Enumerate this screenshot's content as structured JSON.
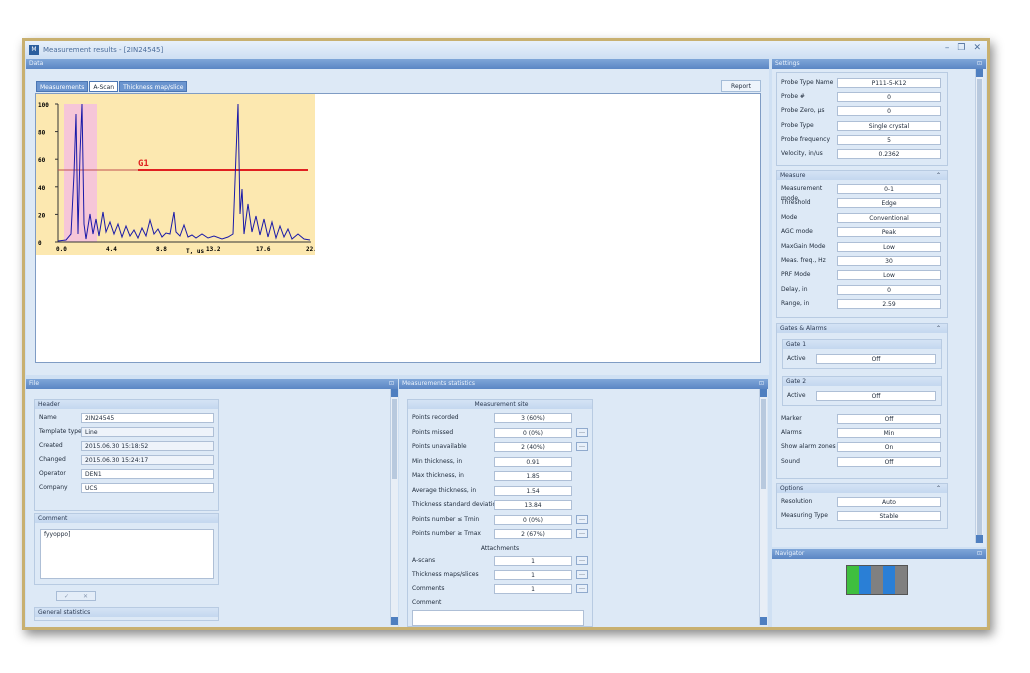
{
  "window": {
    "title": "Measurement results - [2IN24545]"
  },
  "data_panel": {
    "title": "Data",
    "tabs": [
      "Measurements",
      "A-Scan",
      "Thickness map/slice"
    ],
    "report_label": "Report"
  },
  "ascan": {
    "y_ticks": [
      "100",
      "80",
      "60",
      "40",
      "20",
      "0"
    ],
    "x_ticks": [
      "0.0",
      "4.4",
      "8.8",
      "13.2",
      "17.6",
      "22.0"
    ],
    "x_label": "T, us",
    "gate_label": "G1",
    "colors": {
      "bg": "#fce8b0",
      "trace": "#1a1aa8",
      "gate": "#e02020",
      "zone": "#f6c6d8"
    }
  },
  "file_panel": {
    "title": "File",
    "header_group": "Header",
    "fields": [
      {
        "label": "Name",
        "value": "2IN24545"
      },
      {
        "label": "Template type",
        "value": "Line"
      },
      {
        "label": "Created",
        "value": "2015.06.30 15:18:52"
      },
      {
        "label": "Changed",
        "value": "2015.06.30 15:24:17"
      },
      {
        "label": "Operator",
        "value": "DEN1"
      },
      {
        "label": "Company",
        "value": "UCS"
      }
    ],
    "comment_group": "Comment",
    "comment_text": "fyyoppo]",
    "ok": "✓",
    "cancel": "✕",
    "general_stats": "General statistics"
  },
  "stats_panel": {
    "title": "Measurements statistics",
    "site": "Measurement site",
    "rows": [
      {
        "label": "Points recorded",
        "value": "3 (60%)",
        "dots": false
      },
      {
        "label": "Points missed",
        "value": "0 (0%)",
        "dots": true
      },
      {
        "label": "Points unavailable",
        "value": "2 (40%)",
        "dots": true
      },
      {
        "label": "Min thickness, in",
        "value": "0.91",
        "dots": false
      },
      {
        "label": "Max thickness, in",
        "value": "1.85",
        "dots": false
      },
      {
        "label": "Average thickness, in",
        "value": "1.54",
        "dots": false
      },
      {
        "label": "Thickness standard deviation",
        "value": "13.84",
        "dots": false
      },
      {
        "label": "Points number ≤ Tmin",
        "value": "0 (0%)",
        "dots": true
      },
      {
        "label": "Points number ≥ Tmax",
        "value": "2 (67%)",
        "dots": true
      }
    ],
    "attachments": "Attachments",
    "att_rows": [
      {
        "label": "A-scans",
        "value": "1"
      },
      {
        "label": "Thickness maps/slices",
        "value": "1"
      },
      {
        "label": "Comments",
        "value": "1"
      }
    ],
    "comment": "Comment"
  },
  "settings": {
    "title": "Settings",
    "probe": [
      {
        "label": "Probe Type Name",
        "value": "P111-5-K12"
      },
      {
        "label": "Probe #",
        "value": "0"
      },
      {
        "label": "Probe Zero, µs",
        "value": "0"
      },
      {
        "label": "Probe Type",
        "value": "Single crystal"
      },
      {
        "label": "Probe frequency",
        "value": "5"
      },
      {
        "label": "Velocity, in/us",
        "value": "0.2362"
      }
    ],
    "measure_title": "Measure",
    "measure": [
      {
        "label": "Measurement mode",
        "value": "0-1"
      },
      {
        "label": "Threshold",
        "value": "Edge"
      },
      {
        "label": "Mode",
        "value": "Conventional"
      },
      {
        "label": "AGC mode",
        "value": "Peak"
      },
      {
        "label": "MaxGain Mode",
        "value": "Low"
      },
      {
        "label": "Meas. freq., Hz",
        "value": "30"
      },
      {
        "label": "PRF Mode",
        "value": "Low"
      },
      {
        "label": "Delay, in",
        "value": "0"
      },
      {
        "label": "Range, in",
        "value": "2.59"
      }
    ],
    "gates_title": "Gates & Alarms",
    "gate1": "Gate 1",
    "gate2": "Gate 2",
    "active": "Active",
    "gate1_val": "Off",
    "gate2_val": "Off",
    "alarms": [
      {
        "label": "Marker",
        "value": "Off"
      },
      {
        "label": "Alarms",
        "value": "Min"
      },
      {
        "label": "Show alarm zones",
        "value": "On"
      },
      {
        "label": "Sound",
        "value": "Off"
      }
    ],
    "options_title": "Options",
    "options": [
      {
        "label": "Resolution",
        "value": "Auto"
      },
      {
        "label": "Measuring Type",
        "value": "Stable"
      }
    ]
  },
  "navigator": {
    "title": "Navigator",
    "cells": [
      {
        "color": "#3fbf3f"
      },
      {
        "color": "#2a7fd6"
      },
      {
        "color": "#808080"
      },
      {
        "color": "#2a7fd6"
      },
      {
        "color": "#808080"
      }
    ]
  }
}
